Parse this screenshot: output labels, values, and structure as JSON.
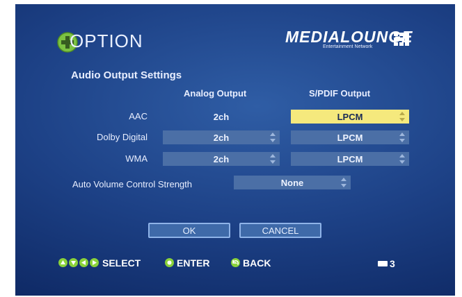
{
  "header": {
    "title": "OPTION"
  },
  "brand": {
    "name": "MEDIALOUNGE",
    "tagline": "Entertainment Network"
  },
  "section": {
    "title": "Audio Output Settings"
  },
  "columns": {
    "analog": "Analog Output",
    "spdif": "S/PDIF Output"
  },
  "rows": [
    {
      "label": "AAC",
      "analog": "2ch",
      "spdif": "LPCM"
    },
    {
      "label": "Dolby Digital",
      "analog": "2ch",
      "spdif": "LPCM"
    },
    {
      "label": "WMA",
      "analog": "2ch",
      "spdif": "LPCM"
    }
  ],
  "auto_volume": {
    "label": "Auto Volume Control Strength",
    "value": "None"
  },
  "buttons": {
    "ok": "OK",
    "cancel": "CANCEL"
  },
  "nav": {
    "select": "SELECT",
    "enter": "ENTER",
    "back": "BACK"
  },
  "status": {
    "page_number": "3"
  },
  "colors": {
    "background": "#1d4186",
    "field": "#4b6fa6",
    "highlight": "#f5e97d",
    "nav_icon": "#8ad23a"
  }
}
